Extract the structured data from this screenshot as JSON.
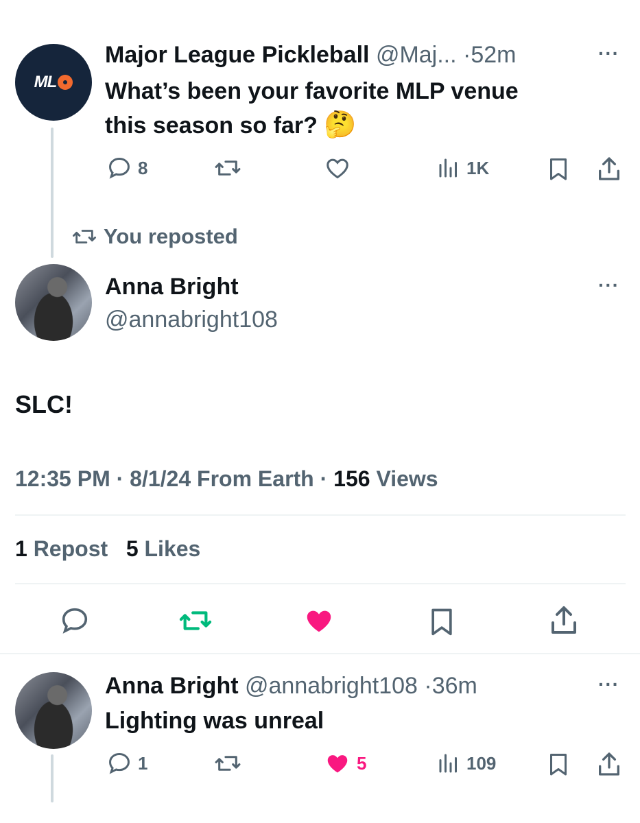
{
  "parent_tweet": {
    "author_name": "Major League Pickleball",
    "author_handle": "@Maj...",
    "separator": "·",
    "time": "52m",
    "avatar_text": "ML",
    "text_line1": "What’s been your favorite MLP venue",
    "text_line2": "this season so far?",
    "emoji": "🤔",
    "replies": "8",
    "retweets": "",
    "likes": "",
    "views": "1K"
  },
  "repost_banner": {
    "label": "You reposted"
  },
  "main_tweet": {
    "author_name": "Anna Bright",
    "author_handle": "@annabright108",
    "text": "SLC!",
    "time": "12:35 PM",
    "date": "8/1/24",
    "source": "From Earth",
    "views_count": "156",
    "views_label": "Views",
    "repost_count": "1",
    "repost_label": "Repost",
    "likes_count": "5",
    "likes_label": "Likes"
  },
  "reply_tweet": {
    "author_name": "Anna Bright",
    "author_handle": "@annabright108",
    "separator": "·",
    "time": "36m",
    "text": "Lighting was unreal",
    "replies": "1",
    "retweets": "",
    "likes": "5",
    "views": "109"
  },
  "colors": {
    "accent_like": "#f91880",
    "accent_retweet": "#00ba7c",
    "muted": "#536471",
    "text": "#0f1419",
    "mlp_navy": "#15253b",
    "mlp_orange": "#f26a2e"
  }
}
